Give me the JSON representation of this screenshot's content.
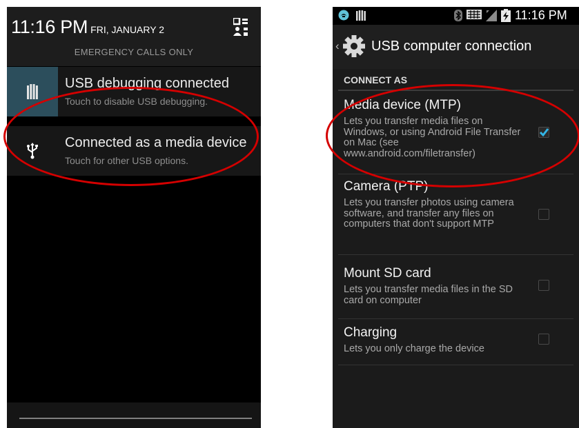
{
  "left_screen": {
    "clock": "11:16 PM",
    "date": "FRI, JANUARY 2",
    "emergency_text": "EMERGENCY CALLS ONLY",
    "notifications": [
      {
        "title": "USB debugging connected",
        "subtitle": "Touch to disable USB debugging.",
        "icon": "usb-debug-icon"
      },
      {
        "title": "Connected as a media device",
        "subtitle": "Touch for other USB options.",
        "icon": "usb-icon"
      }
    ]
  },
  "right_screen": {
    "status_time": "11:16 PM",
    "title": "USB computer connection",
    "section_header": "CONNECT AS",
    "options": [
      {
        "title": "Media device (MTP)",
        "description": "Lets you transfer media files on Windows, or using Android File Transfer on Mac (see www.android.com/filetransfer)",
        "checked": true
      },
      {
        "title": "Camera (PTP)",
        "description": "Lets you transfer photos using camera software, and transfer any files on computers that don't support MTP",
        "checked": false
      },
      {
        "title": "Mount SD card",
        "description": "Lets you transfer media files in the SD card on computer",
        "checked": false
      },
      {
        "title": "Charging",
        "description": "Lets you only charge the device",
        "checked": false
      }
    ]
  },
  "colors": {
    "highlight_ellipse": "#d40000",
    "checkbox_accent": "#33b5e5",
    "selected_notification_icon_bg": "#2c4e5c"
  }
}
